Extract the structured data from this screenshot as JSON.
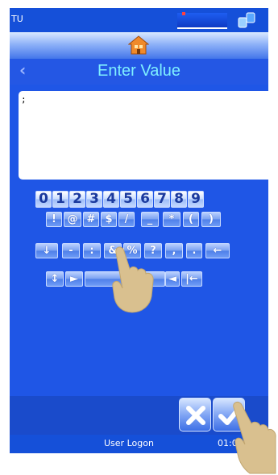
{
  "status_bar": {
    "app_name": "TU"
  },
  "title": {
    "back_icon": "chevron-left-icon",
    "text": "Enter Value"
  },
  "input": {
    "value": ";"
  },
  "keyboard": {
    "row1": [
      "0",
      "1",
      "2",
      "3",
      "4",
      "5",
      "6",
      "7",
      "8",
      "9"
    ],
    "row2": [
      "!",
      "@",
      "#",
      "$",
      "/",
      "_",
      "*",
      "(",
      ")"
    ],
    "row3": [
      "↓",
      "-",
      ":",
      "&",
      "%",
      "?",
      ",",
      ".",
      "←"
    ],
    "row4": [
      "↕",
      "►",
      "",
      "◄",
      "|←"
    ]
  },
  "footer": {
    "cancel_icon": "close-icon",
    "ok_icon": "check-icon"
  },
  "bottom_status": {
    "user": "User Logon",
    "time": "01:01"
  },
  "colors": {
    "screen_bg": "#1f56e6",
    "title_text": "#7ff0ff",
    "hand": "#d9c08f"
  }
}
